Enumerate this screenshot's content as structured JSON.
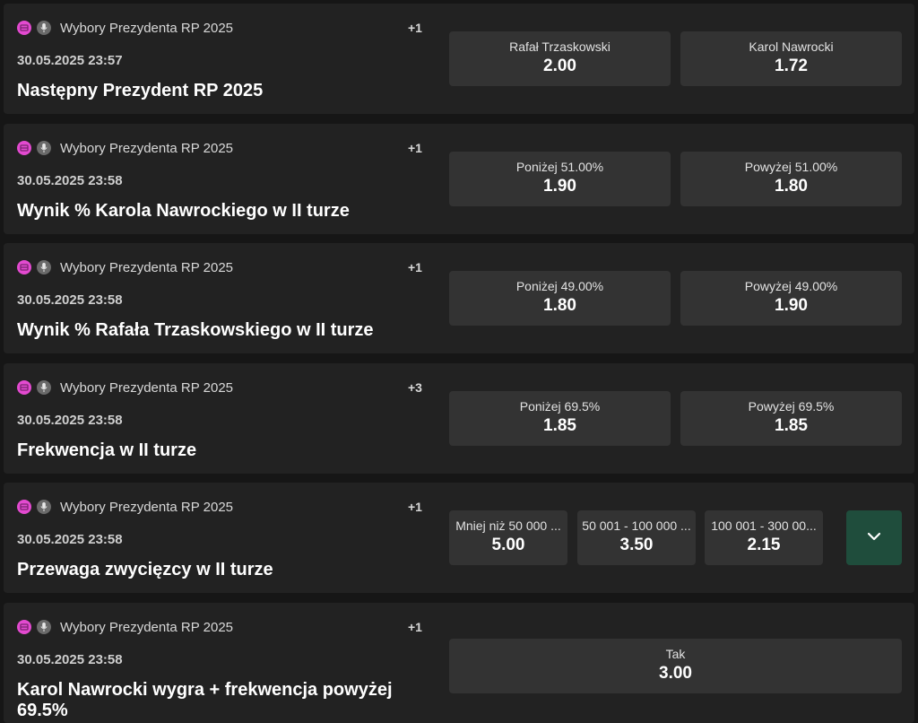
{
  "events": [
    {
      "league": "Wybory Prezydenta RP 2025",
      "more": "+1",
      "datetime": "30.05.2025 23:57",
      "title": "Następny Prezydent RP 2025",
      "outcomes": [
        {
          "label": "Rafał Trzaskowski",
          "odds": "2.00"
        },
        {
          "label": "Karol Nawrocki",
          "odds": "1.72"
        }
      ]
    },
    {
      "league": "Wybory Prezydenta RP 2025",
      "more": "+1",
      "datetime": "30.05.2025 23:58",
      "title": "Wynik % Karola Nawrockiego w II turze",
      "outcomes": [
        {
          "label": "Poniżej 51.00%",
          "odds": "1.90"
        },
        {
          "label": "Powyżej 51.00%",
          "odds": "1.80"
        }
      ]
    },
    {
      "league": "Wybory Prezydenta RP 2025",
      "more": "+1",
      "datetime": "30.05.2025 23:58",
      "title": "Wynik % Rafała Trzaskowskiego w II turze",
      "outcomes": [
        {
          "label": "Poniżej 49.00%",
          "odds": "1.80"
        },
        {
          "label": "Powyżej 49.00%",
          "odds": "1.90"
        }
      ]
    },
    {
      "league": "Wybory Prezydenta RP 2025",
      "more": "+3",
      "datetime": "30.05.2025 23:58",
      "title": "Frekwencja w II turze",
      "outcomes": [
        {
          "label": "Poniżej 69.5%",
          "odds": "1.85"
        },
        {
          "label": "Powyżej 69.5%",
          "odds": "1.85"
        }
      ]
    },
    {
      "league": "Wybory Prezydenta RP 2025",
      "more": "+1",
      "datetime": "30.05.2025 23:58",
      "title": "Przewaga zwycięzcy w II turze",
      "outcomes": [
        {
          "label": "Mniej niż 50 000 ...",
          "odds": "5.00"
        },
        {
          "label": "50 001 - 100 000 ...",
          "odds": "3.50"
        },
        {
          "label": "100 001 - 300 00...",
          "odds": "2.15"
        }
      ],
      "expand_icon": "chevron-down-icon"
    },
    {
      "league": "Wybory Prezydenta RP 2025",
      "more": "+1",
      "datetime": "30.05.2025 23:58",
      "title": "Karol Nawrocki wygra + frekwencja powyżej 69.5%",
      "outcomes": [
        {
          "label": "Tak",
          "odds": "3.00"
        }
      ]
    }
  ],
  "icons": {
    "country": "poland-flag-icon",
    "category": "microphone-icon"
  },
  "colors": {
    "background": "#161616",
    "card": "#222222",
    "odd_button": "#333333",
    "country_icon": "#e34ad0",
    "expand_button": "#1f4d3c"
  }
}
